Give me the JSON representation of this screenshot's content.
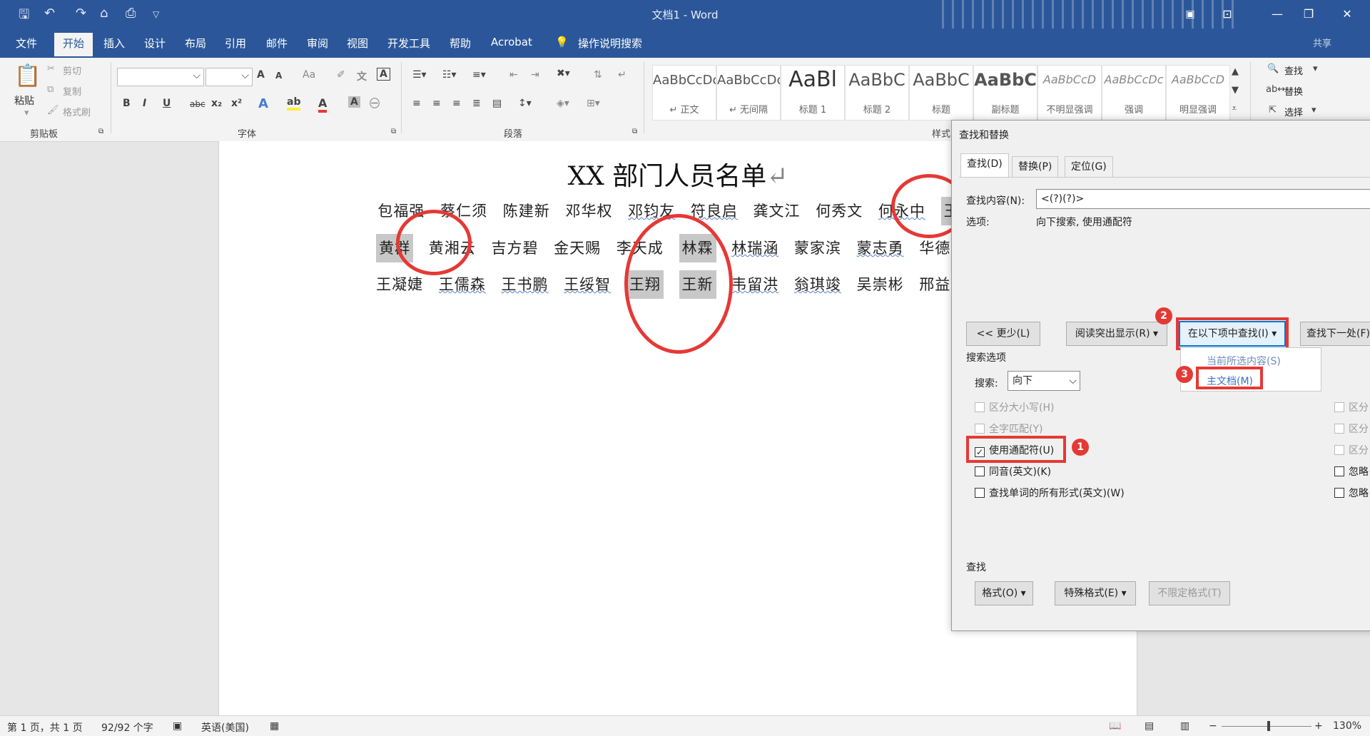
{
  "titlebar": {
    "title": "文档1 - Word",
    "share": "共享"
  },
  "menu": [
    "文件",
    "开始",
    "插入",
    "设计",
    "布局",
    "引用",
    "邮件",
    "审阅",
    "视图",
    "开发工具",
    "帮助",
    "Acrobat"
  ],
  "tell_me": "操作说明搜索",
  "ribbon": {
    "clipboard": {
      "paste": "粘贴",
      "cut": "剪切",
      "copy": "复制",
      "format_painter": "格式刷",
      "label": "剪贴板"
    },
    "font": {
      "label": "字体",
      "b": "B",
      "i": "I",
      "u": "U",
      "abc": "abc",
      "sub": "x₂",
      "sup": "x²",
      "grow": "A",
      "shrink": "A",
      "aa": "Aa"
    },
    "paragraph": {
      "label": "段落"
    },
    "styles": {
      "label": "样式",
      "items": [
        {
          "sample": "AaBbCcDc",
          "name": "↵ 正文"
        },
        {
          "sample": "AaBbCcDc",
          "name": "↵ 无间隔"
        },
        {
          "sample": "AaBl",
          "name": "标题 1"
        },
        {
          "sample": "AaBbC",
          "name": "标题 2"
        },
        {
          "sample": "AaBbC",
          "name": "标题"
        },
        {
          "sample": "AaBbC",
          "name": "副标题"
        },
        {
          "sample": "AaBbCcD",
          "name": "不明显强调"
        },
        {
          "sample": "AaBbCcDc",
          "name": "强调"
        },
        {
          "sample": "AaBbCcD",
          "name": "明显强调"
        }
      ]
    },
    "editing": {
      "find": "查找",
      "replace": "替换",
      "select": "选择"
    }
  },
  "document": {
    "title": "XX 部门人员名单",
    "line1": [
      "包福强",
      "蔡仁须",
      "陈建新",
      "邓华权",
      "邓钧友",
      "符良启",
      "龚文江",
      "何秀文",
      "何永中",
      "王君"
    ],
    "line2": [
      "黄群",
      "黄湘云",
      "吉方碧",
      "金天赐",
      "李天成",
      "林霖",
      "林瑞涵",
      "蒙家滨",
      "蒙志勇",
      "华德锋"
    ],
    "line3": [
      "王凝婕",
      "王儒森",
      "王书鹏",
      "王绥智",
      "王翔",
      "王新",
      "韦留洪",
      "翁琪竣",
      "吴崇彬",
      "邢益译"
    ]
  },
  "dialog": {
    "title": "查找和替换",
    "tabs": [
      "查找(D)",
      "替换(P)",
      "定位(G)"
    ],
    "find_label": "查找内容(N):",
    "find_value": "<(?)(?)>",
    "options_label": "选项:",
    "options_value": "向下搜索, 使用通配符",
    "less_button": "<< 更少(L)",
    "reading_highlight": "阅读突出显示(R)",
    "find_in": "在以下项中查找(I)",
    "find_next": "查找下一处(F)",
    "find_in_menu": [
      "当前所选内容(S)",
      "主文档(M)"
    ],
    "search_options": "搜索选项",
    "search_label": "搜索:",
    "search_value": "向下",
    "checkboxes": [
      {
        "label": "区分大小写(H)",
        "checked": false,
        "disabled": true
      },
      {
        "label": "全字匹配(Y)",
        "checked": false,
        "disabled": true
      },
      {
        "label": "使用通配符(U)",
        "checked": true,
        "disabled": false
      },
      {
        "label": "同音(英文)(K)",
        "checked": false,
        "disabled": false
      },
      {
        "label": "查找单词的所有形式(英文)(W)",
        "checked": false,
        "disabled": false
      }
    ],
    "right_checks": [
      "区分",
      "区分",
      "区分",
      "忽略",
      "忽略"
    ],
    "find_section": "查找",
    "format_button": "格式(O)",
    "special_button": "特殊格式(E)",
    "no_format_button": "不限定格式(T)",
    "badges": [
      "1",
      "2",
      "3"
    ]
  },
  "statusbar": {
    "page": "第 1 页，共 1 页",
    "words": "92/92 个字",
    "lang": "英语(美国)",
    "zoom": "130%"
  }
}
